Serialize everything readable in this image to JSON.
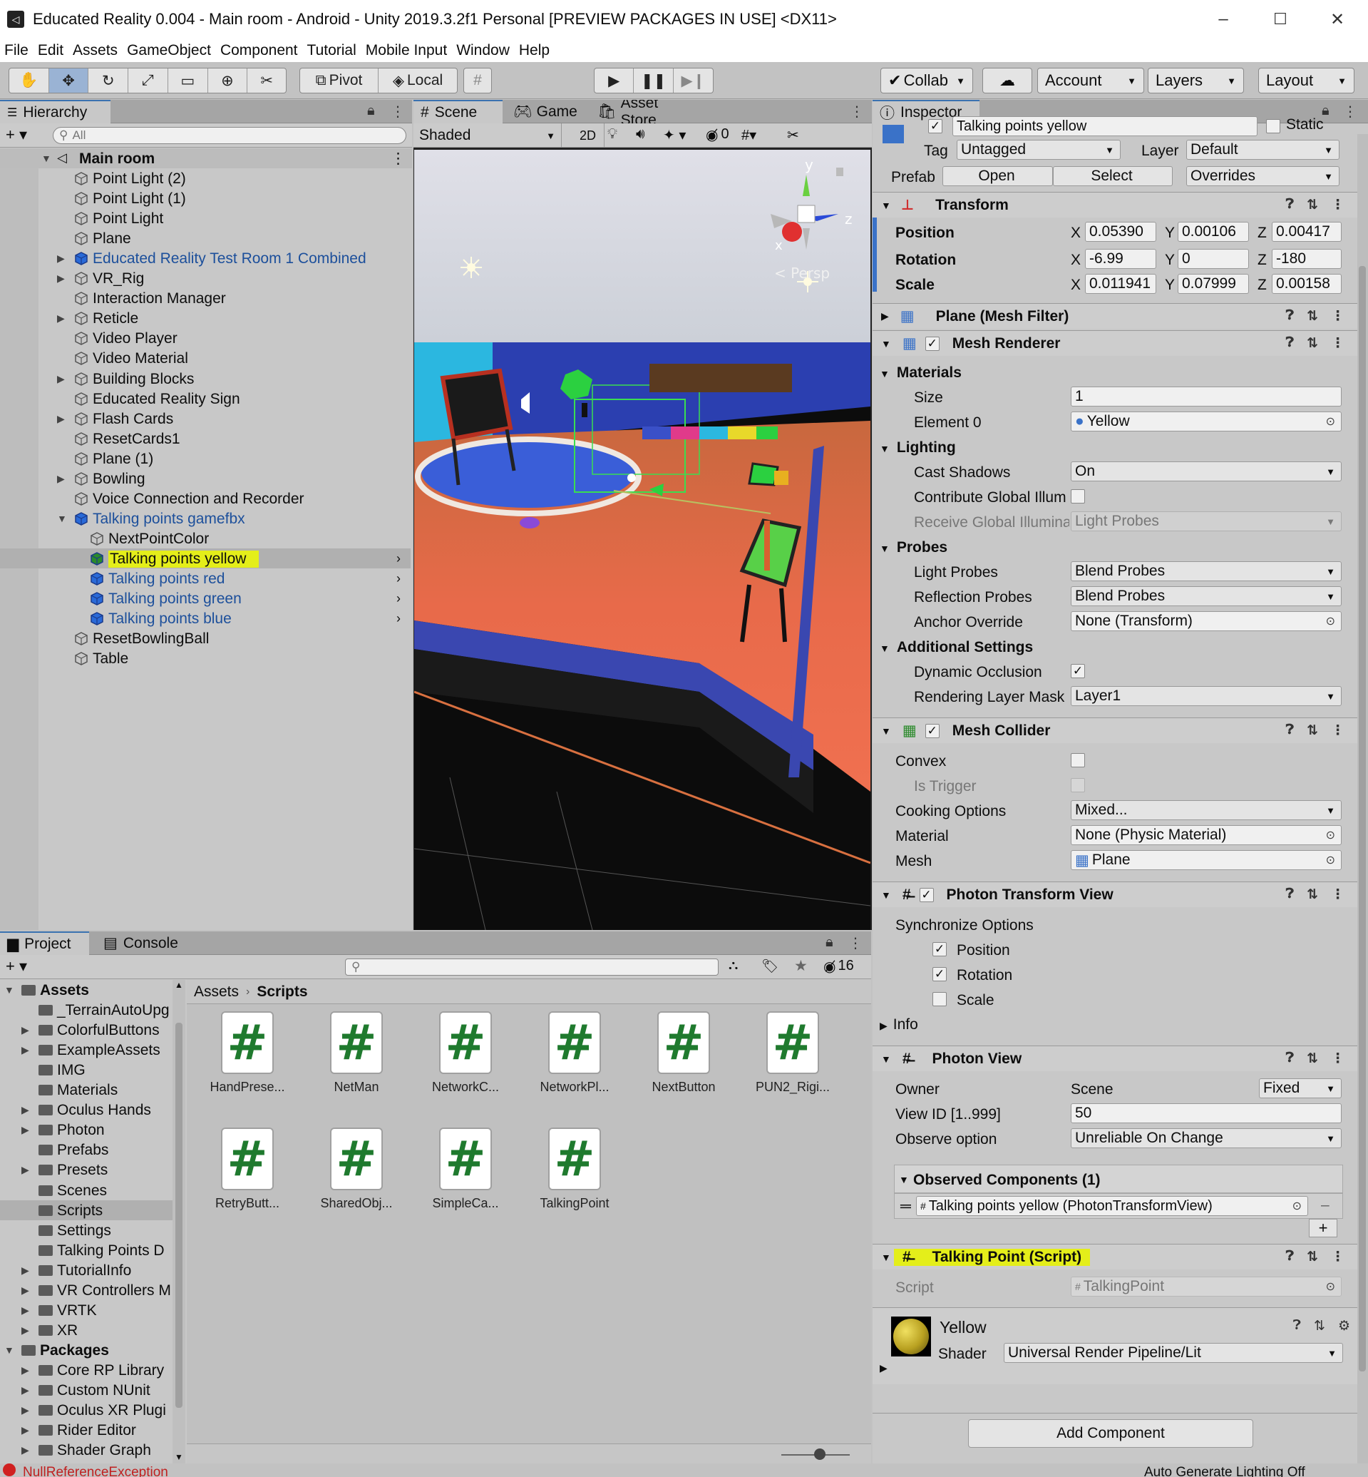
{
  "window": {
    "title": "Educated Reality 0.004 - Main room - Android - Unity 2019.3.2f1 Personal [PREVIEW PACKAGES IN USE] <DX11>",
    "minimize": "–",
    "maximize": "☐",
    "close": "✕"
  },
  "menu": [
    "File",
    "Edit",
    "Assets",
    "GameObject",
    "Component",
    "Tutorial",
    "Mobile Input",
    "Window",
    "Help"
  ],
  "toolbar": {
    "pivot": "Pivot",
    "local": "Local",
    "collab": "Collab",
    "account": "Account",
    "layers": "Layers",
    "layout": "Layout"
  },
  "hierarchy": {
    "tab": "Hierarchy",
    "search_placeholder": "All",
    "scene": "Main room",
    "items": [
      {
        "label": "Point Light (2)",
        "indent": 0,
        "fold": false,
        "prefab": false
      },
      {
        "label": "Point Light (1)",
        "indent": 0,
        "fold": false,
        "prefab": false
      },
      {
        "label": "Point Light",
        "indent": 0,
        "fold": false,
        "prefab": false
      },
      {
        "label": "Plane",
        "indent": 0,
        "fold": false,
        "prefab": false
      },
      {
        "label": "Educated Reality Test Room 1 Combined",
        "indent": 0,
        "fold": true,
        "prefab": true
      },
      {
        "label": "VR_Rig",
        "indent": 0,
        "fold": true,
        "prefab": false
      },
      {
        "label": "Interaction Manager",
        "indent": 0,
        "fold": false,
        "prefab": false
      },
      {
        "label": "Reticle",
        "indent": 0,
        "fold": true,
        "prefab": false
      },
      {
        "label": "Video Player",
        "indent": 0,
        "fold": false,
        "prefab": false
      },
      {
        "label": "Video Material",
        "indent": 0,
        "fold": false,
        "prefab": false
      },
      {
        "label": "Building Blocks",
        "indent": 0,
        "fold": true,
        "prefab": false
      },
      {
        "label": "Educated Reality Sign",
        "indent": 0,
        "fold": false,
        "prefab": false
      },
      {
        "label": "Flash Cards",
        "indent": 0,
        "fold": true,
        "prefab": false
      },
      {
        "label": "ResetCards1",
        "indent": 0,
        "fold": false,
        "prefab": false
      },
      {
        "label": "Plane (1)",
        "indent": 0,
        "fold": false,
        "prefab": false
      },
      {
        "label": "Bowling",
        "indent": 0,
        "fold": true,
        "prefab": false
      },
      {
        "label": "Voice Connection and Recorder",
        "indent": 0,
        "fold": false,
        "prefab": false
      },
      {
        "label": "Talking points gamefbx",
        "indent": 0,
        "fold": "open",
        "prefab": true
      },
      {
        "label": "NextPointColor",
        "indent": 1,
        "fold": false,
        "prefab": false
      },
      {
        "label": "Talking points yellow",
        "indent": 1,
        "fold": false,
        "prefab": true,
        "selected": true
      },
      {
        "label": "Talking points red",
        "indent": 1,
        "fold": false,
        "prefab": true
      },
      {
        "label": "Talking points green",
        "indent": 1,
        "fold": false,
        "prefab": true
      },
      {
        "label": "Talking points blue",
        "indent": 1,
        "fold": false,
        "prefab": true
      },
      {
        "label": "ResetBowlingBall",
        "indent": 0,
        "fold": false,
        "prefab": false
      },
      {
        "label": "Table",
        "indent": 0,
        "fold": false,
        "prefab": false
      }
    ]
  },
  "scene": {
    "tabs": [
      "Scene",
      "Game",
      "Asset Store"
    ],
    "shading": "Shaded",
    "mode2d": "2D",
    "hidden_count": "0",
    "persp": "< Persp",
    "axes": {
      "y": "y",
      "z": "z",
      "x": "x"
    }
  },
  "inspector": {
    "tab": "Inspector",
    "object_name": "Talking points yellow",
    "static": "Static",
    "tag_label": "Tag",
    "tag": "Untagged",
    "layer_label": "Layer",
    "layer": "Default",
    "prefab_label": "Prefab",
    "open": "Open",
    "select": "Select",
    "overrides": "Overrides",
    "transform": {
      "title": "Transform",
      "position": {
        "label": "Position",
        "x": "0.05390",
        "y": "0.00106",
        "z": "0.00417"
      },
      "rotation": {
        "label": "Rotation",
        "x": "-6.99",
        "y": "0",
        "z": "-180"
      },
      "scale": {
        "label": "Scale",
        "x": "0.011941",
        "y": "0.07999",
        "z": "0.00158"
      }
    },
    "mesh_filter": "Plane (Mesh Filter)",
    "mesh_renderer": {
      "title": "Mesh Renderer",
      "materials": "Materials",
      "size_label": "Size",
      "size": "1",
      "element0_label": "Element 0",
      "element0": "Yellow",
      "lighting": "Lighting",
      "cast_shadows_label": "Cast Shadows",
      "cast_shadows": "On",
      "contribute_gi": "Contribute Global Illum",
      "receive_gi_label": "Receive Global Illumina",
      "receive_gi": "Light Probes",
      "probes": "Probes",
      "light_probes_label": "Light Probes",
      "light_probes": "Blend Probes",
      "reflection_probes_label": "Reflection Probes",
      "reflection_probes": "Blend Probes",
      "anchor_label": "Anchor Override",
      "anchor": "None (Transform)",
      "additional": "Additional Settings",
      "dynamic_occlusion": "Dynamic Occlusion",
      "rendering_layer_label": "Rendering Layer Mask",
      "rendering_layer": "Layer1"
    },
    "mesh_collider": {
      "title": "Mesh Collider",
      "convex": "Convex",
      "is_trigger": "Is Trigger",
      "cooking_label": "Cooking Options",
      "cooking": "Mixed...",
      "material_label": "Material",
      "material": "None (Physic Material)",
      "mesh_label": "Mesh",
      "mesh": "Plane"
    },
    "photon_transform": {
      "title": "Photon Transform View",
      "sync": "Synchronize Options",
      "position": "Position",
      "rotation": "Rotation",
      "scale": "Scale",
      "info": "Info"
    },
    "photon_view": {
      "title": "Photon View",
      "owner_label": "Owner",
      "owner": "Scene",
      "owner_mode": "Fixed",
      "viewid_label": "View ID [1..999]",
      "viewid": "50",
      "observe_label": "Observe option",
      "observe": "Unreliable On Change",
      "observed": "Observed Components (1)",
      "observed_item": "Talking points yellow (PhotonTransformView)",
      "minus": "–",
      "plus": "+"
    },
    "talking_point": {
      "title": "Talking Point (Script)",
      "script_label": "Script",
      "script": "TalkingPoint"
    },
    "material": {
      "name": "Yellow",
      "shader_label": "Shader",
      "shader": "Universal Render Pipeline/Lit"
    },
    "add_component": "Add Component"
  },
  "project": {
    "tabs": [
      "Project",
      "Console"
    ],
    "hidden_count": "16",
    "breadcrumb": [
      "Assets",
      "Scripts"
    ],
    "tree": [
      {
        "label": "Assets",
        "level": 0,
        "fold": "open",
        "bold": true
      },
      {
        "label": "_TerrainAutoUpg",
        "level": 1,
        "fold": false
      },
      {
        "label": "ColorfulButtons",
        "level": 1,
        "fold": true
      },
      {
        "label": "ExampleAssets",
        "level": 1,
        "fold": true
      },
      {
        "label": "IMG",
        "level": 1,
        "fold": false
      },
      {
        "label": "Materials",
        "level": 1,
        "fold": false
      },
      {
        "label": "Oculus Hands",
        "level": 1,
        "fold": true
      },
      {
        "label": "Photon",
        "level": 1,
        "fold": true
      },
      {
        "label": "Prefabs",
        "level": 1,
        "fold": false
      },
      {
        "label": "Presets",
        "level": 1,
        "fold": true
      },
      {
        "label": "Scenes",
        "level": 1,
        "fold": false
      },
      {
        "label": "Scripts",
        "level": 1,
        "fold": false,
        "selected": true
      },
      {
        "label": "Settings",
        "level": 1,
        "fold": false
      },
      {
        "label": "Talking Points D",
        "level": 1,
        "fold": false
      },
      {
        "label": "TutorialInfo",
        "level": 1,
        "fold": true
      },
      {
        "label": "VR Controllers M",
        "level": 1,
        "fold": true
      },
      {
        "label": "VRTK",
        "level": 1,
        "fold": true
      },
      {
        "label": "XR",
        "level": 1,
        "fold": true
      },
      {
        "label": "Packages",
        "level": 0,
        "fold": "open",
        "bold": true
      },
      {
        "label": "Core RP Library",
        "level": 1,
        "fold": true
      },
      {
        "label": "Custom NUnit",
        "level": 1,
        "fold": true
      },
      {
        "label": "Oculus XR Plugi",
        "level": 1,
        "fold": true
      },
      {
        "label": "Rider Editor",
        "level": 1,
        "fold": true
      },
      {
        "label": "Shader Graph",
        "level": 1,
        "fold": true
      }
    ],
    "assets": [
      "HandPrese...",
      "NetMan",
      "NetworkC...",
      "NetworkPl...",
      "NextButton",
      "PUN2_Rigi...",
      "RetryButt...",
      "SharedObj...",
      "SimpleCa...",
      "TalkingPoint"
    ],
    "asset_glyph": "#"
  },
  "status": {
    "error": "NullReferenceException",
    "right": "Auto Generate Lighting Off"
  }
}
